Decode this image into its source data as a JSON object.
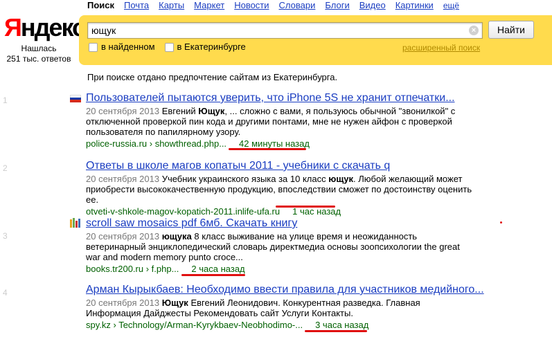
{
  "logo": {
    "text_ya": "Я",
    "text_rest": "ндекс"
  },
  "found": {
    "line1": "Нашлась",
    "line2": "251 тыс. ответов"
  },
  "services": {
    "active": "Поиск",
    "links": [
      "Почта",
      "Карты",
      "Маркет",
      "Новости",
      "Словари",
      "Блоги",
      "Видео",
      "Картинки"
    ],
    "more": "ещё"
  },
  "search": {
    "query": "ющук",
    "button": "Найти",
    "check_found": "в найденном",
    "check_city": "в Екатеринбурге",
    "advanced": "расширенный поиск"
  },
  "preference_note": "При поиске отдано предпочтение сайтам из Екатеринбурга.",
  "results": [
    {
      "num": "1",
      "title": "Пользователей пытаются уверить, что iPhone 5S не хранит отпечатки...",
      "date": "20 сентября 2013",
      "snippet_before": " Евгений ",
      "snippet_bold": "Ющук",
      "snippet_after": ", ... сложно с вами, я пользуюсь обычной \"звонилкой\" с отключенной проверкой пин кода и другими понтами, мне не нужен айфон с проверкой пользователя по папилярному узору.",
      "url": "police-russia.ru › showthread.php...",
      "time": "42 минуты назад"
    },
    {
      "num": "2",
      "title": "Ответы в школе магов копатыч 2011 - учебники с скачать q",
      "date": "20 сентября 2013",
      "snippet_before": " Учебник украинского языка за 10 класс ",
      "snippet_bold": "ющук",
      "snippet_after": ". Любой желающий может приобрести высококачественную продукцию, впоследствии сможет по достоинству оценить ее.",
      "url": "otveti-v-shkole-magov-kopatich-2011.inlife-ufa.ru",
      "time": "1 час назад"
    },
    {
      "num": "3",
      "title": "scroll saw mosaics pdf 6мб. Скачать книгу",
      "date": "20 сентября 2013",
      "snippet_before": " ",
      "snippet_bold": "ющука",
      "snippet_after": " 8 класс выживание на улице время и неожиданность ветеринарный энциклопедический словарь директмедиа основы зоопсихологии the great war and modern memory punto croce...",
      "url": "books.tr200.ru › f.php...",
      "time": "2 часа назад"
    },
    {
      "num": "4",
      "title": "Арман Кырыкбаев: Необходимо ввести правила для участников медийного...",
      "date": "20 сентября 2013",
      "snippet_before": " ",
      "snippet_bold": "Ющук",
      "snippet_after": " Евгений Леонидович. Конкурентная разведка. Главная Информация Дайджесты Рекомендовать сайт Услуги Контакты.",
      "url": "spy.kz › Technology/Arman-Kyrykbaev-Neobhodimo-...",
      "time": "3 часа назад"
    }
  ],
  "colors": {
    "link": "#1a3dc1",
    "green": "#006000",
    "yellow": "#ffdb4d",
    "red": "#e01010"
  }
}
